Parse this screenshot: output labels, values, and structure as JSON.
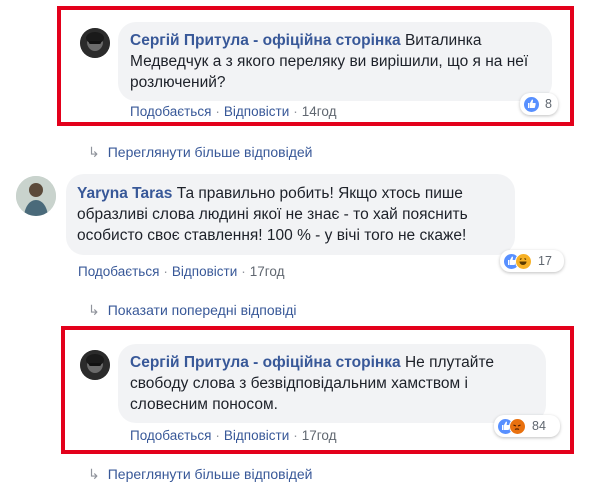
{
  "colors": {
    "link_blue": "#385898",
    "meta_gray": "#606770",
    "bubble_bg": "#f2f3f5",
    "highlight_red": "#e3001b",
    "like_blue": "#5890ff"
  },
  "comments": [
    {
      "author": "Сергій Притула - офіційна сторінка",
      "text": "Виталинка Медведчук а з якого переляку ви вирішили, що я на неї розлючений?",
      "like_label": "Подобається",
      "reply_label": "Відповісти",
      "time": "14год",
      "reaction_count": "8",
      "reactions": [
        "like-icon"
      ]
    },
    {
      "author": "Yaryna Taras",
      "text": "Та правильно робить! Якщо хтось пише образливі слова людині якої не знає - то хай пояснить особисто своє ставлення! 100 % - у вічі того не скаже!",
      "like_label": "Подобається",
      "reply_label": "Відповісти",
      "time": "17год",
      "reaction_count": "17",
      "reactions": [
        "like-icon",
        "haha-icon"
      ]
    },
    {
      "author": "Сергій Притула - офіційна сторінка",
      "text": "Не плутайте свободу слова з безвідповідальним хамством і словесним поносом.",
      "like_label": "Подобається",
      "reply_label": "Відповісти",
      "time": "17год",
      "reaction_count": "84",
      "reactions": [
        "like-icon",
        "angry-icon"
      ]
    }
  ],
  "links": {
    "more_replies_1": "Переглянути більше відповідей",
    "previous_replies": "Показати попередні відповіді",
    "more_replies_2": "Переглянути більше відповідей"
  },
  "reply_arrow_icon": "reply-arrow-icon",
  "dot_separator": "·"
}
